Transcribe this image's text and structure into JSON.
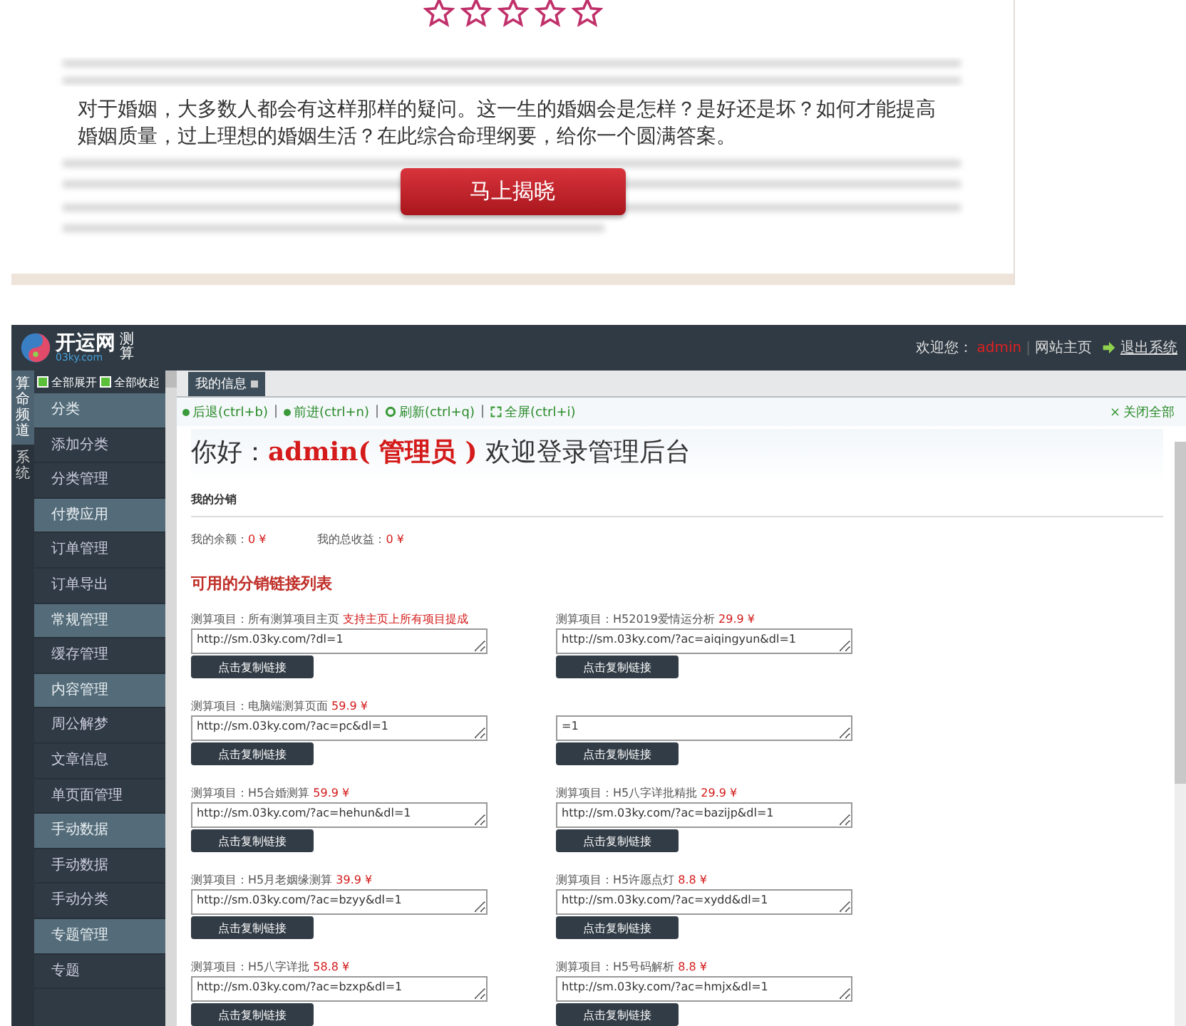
{
  "promo": {
    "description": "对于婚姻，大多数人都会有这样那样的疑问。这一生的婚姻会是怎样？是好还是坏？如何才能提高婚姻质量，过上理想的婚姻生活？在此综合命理纲要，给你一个圆满答案。",
    "button": "马上揭晓"
  },
  "admin": {
    "logo": {
      "name": "开运网",
      "domain": "03ky.com",
      "badge": "测算"
    },
    "header": {
      "welcome": "欢迎您：",
      "user": "admin",
      "separator": "|",
      "home_link": "网站主页",
      "logout": "退出系统"
    },
    "channels": [
      {
        "label": "算命频道",
        "selected": true
      },
      {
        "label": "系统",
        "selected": false
      }
    ],
    "sidebar": {
      "expand_all": "全部展开",
      "collapse_all": "全部收起",
      "items": [
        {
          "label": "分类",
          "kind": "group"
        },
        {
          "label": "添加分类",
          "kind": "item"
        },
        {
          "label": "分类管理",
          "kind": "item"
        },
        {
          "label": "付费应用",
          "kind": "group"
        },
        {
          "label": "订单管理",
          "kind": "item"
        },
        {
          "label": "订单导出",
          "kind": "item"
        },
        {
          "label": "常规管理",
          "kind": "group"
        },
        {
          "label": "缓存管理",
          "kind": "item"
        },
        {
          "label": "内容管理",
          "kind": "group"
        },
        {
          "label": "周公解梦",
          "kind": "item"
        },
        {
          "label": "文章信息",
          "kind": "item"
        },
        {
          "label": "单页面管理",
          "kind": "item"
        },
        {
          "label": "手动数据",
          "kind": "group"
        },
        {
          "label": "手动数据",
          "kind": "item"
        },
        {
          "label": "手动分类",
          "kind": "item"
        },
        {
          "label": "专题管理",
          "kind": "group"
        },
        {
          "label": "专题",
          "kind": "item"
        }
      ]
    },
    "tabs": [
      {
        "label": "我的信息",
        "selected": true
      }
    ],
    "toolbar": [
      {
        "label": "后退(ctrl+b)",
        "kind": "back"
      },
      {
        "separator": "|",
        "label": "前进(ctrl+n)",
        "kind": "forward"
      },
      {
        "separator": "|",
        "label": "刷新(ctrl+q)",
        "kind": "refresh"
      },
      {
        "separator": "|",
        "label": "全屏(ctrl+i)",
        "kind": "fullscreen"
      }
    ],
    "close_all_icon": "×",
    "close_all": "关闭全部",
    "greeting": {
      "before": "你好：",
      "highlight": "admin( 管理员 )",
      "after": "欢迎登录管理后台"
    },
    "section_title": "我的分销",
    "stats": [
      {
        "label": "我的余额：",
        "value": "0 ¥"
      },
      {
        "label": "我的总收益：",
        "value": "0 ¥"
      }
    ],
    "list_title": "可用的分销链接列表",
    "projects": [
      {
        "title": "测算项目：所有测算项目主页",
        "note": "支持主页上所有项目提成",
        "link": "http://sm.03ky.com/?dl=1",
        "button": "点击复制链接"
      },
      {
        "title": "测算项目：H52019爱情运分析",
        "note": "29.9 ¥",
        "link": "http://sm.03ky.com/?ac=aiqingyun&dl=1",
        "button": "点击复制链接"
      },
      {
        "title": "测算项目：电脑端测算页面",
        "note": "59.9 ¥",
        "link": "http://sm.03ky.com/?ac=pc&dl=1",
        "button": "点击复制链接"
      },
      {
        "link": "=1",
        "button": "点击复制链接"
      },
      {
        "title": "测算项目：H5合婚测算",
        "note": "59.9 ¥",
        "link": "http://sm.03ky.com/?ac=hehun&dl=1",
        "button": "点击复制链接"
      },
      {
        "title": "测算项目：H5八字详批精批",
        "note": "29.9 ¥",
        "link": "http://sm.03ky.com/?ac=bazijp&dl=1",
        "button": "点击复制链接"
      },
      {
        "title": "测算项目：H5月老姻缘测算",
        "note": "39.9 ¥",
        "link": "http://sm.03ky.com/?ac=bzyy&dl=1",
        "button": "点击复制链接"
      },
      {
        "title": "测算项目：H5许愿点灯",
        "note": "8.8 ¥",
        "link": "http://sm.03ky.com/?ac=xydd&dl=1",
        "button": "点击复制链接"
      },
      {
        "title": "测算项目：H5八字详批",
        "note": "58.8 ¥",
        "link": "http://sm.03ky.com/?ac=bzxp&dl=1",
        "button": "点击复制链接"
      },
      {
        "title": "测算项目：H5号码解析",
        "note": "8.8 ¥",
        "link": "http://sm.03ky.com/?ac=hmjx&dl=1",
        "button": "点击复制链接"
      }
    ]
  }
}
